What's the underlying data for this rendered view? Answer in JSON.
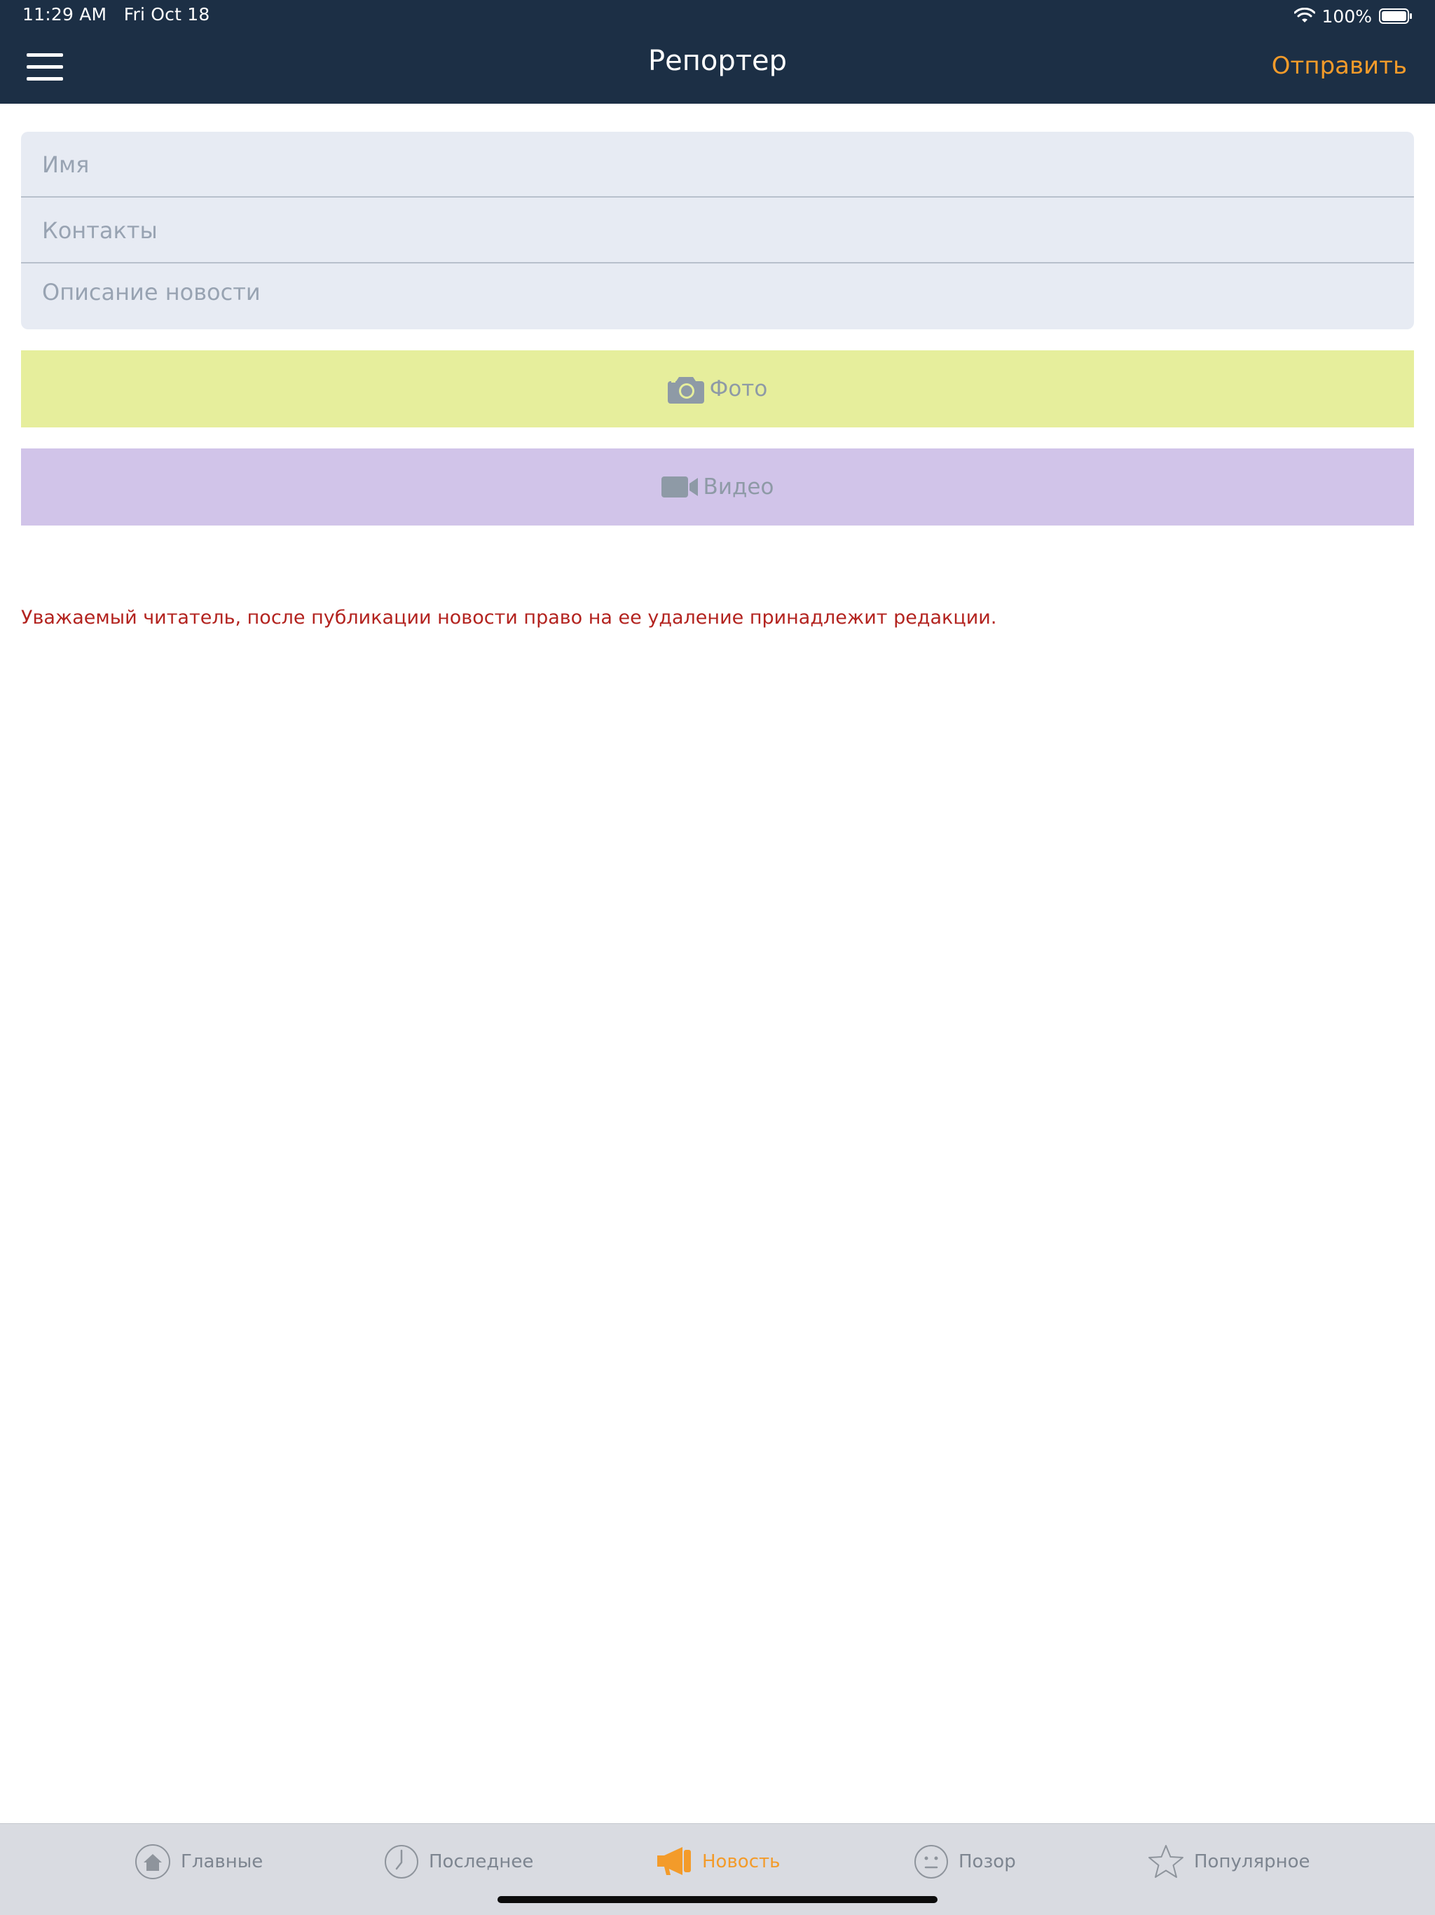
{
  "status_bar": {
    "time": "11:29 AM",
    "date": "Fri Oct 18",
    "battery": "100%"
  },
  "header": {
    "title": "Репортер",
    "send_label": "Отправить"
  },
  "form": {
    "name_placeholder": "Имя",
    "contacts_placeholder": "Контакты",
    "description_placeholder": "Описание новости"
  },
  "media": {
    "photo_label": "Фото",
    "video_label": "Видео"
  },
  "notice": "Уважаемый читатель, после публикации новости право на ее удаление принадлежит редакции.",
  "tabs": [
    {
      "label": "Главные",
      "icon": "home-icon",
      "active": false
    },
    {
      "label": "Последнее",
      "icon": "clock-icon",
      "active": false
    },
    {
      "label": "Новость",
      "icon": "megaphone-icon",
      "active": true
    },
    {
      "label": "Позор",
      "icon": "neutral-face-icon",
      "active": false
    },
    {
      "label": "Популярное",
      "icon": "star-icon",
      "active": false
    }
  ],
  "colors": {
    "header_bg": "#1c2f45",
    "accent": "#f39b2a",
    "photo_bg": "#e6ee9c",
    "video_bg": "#d1c4e9",
    "notice": "#b3231f",
    "field_bg": "#e7ebf3"
  }
}
